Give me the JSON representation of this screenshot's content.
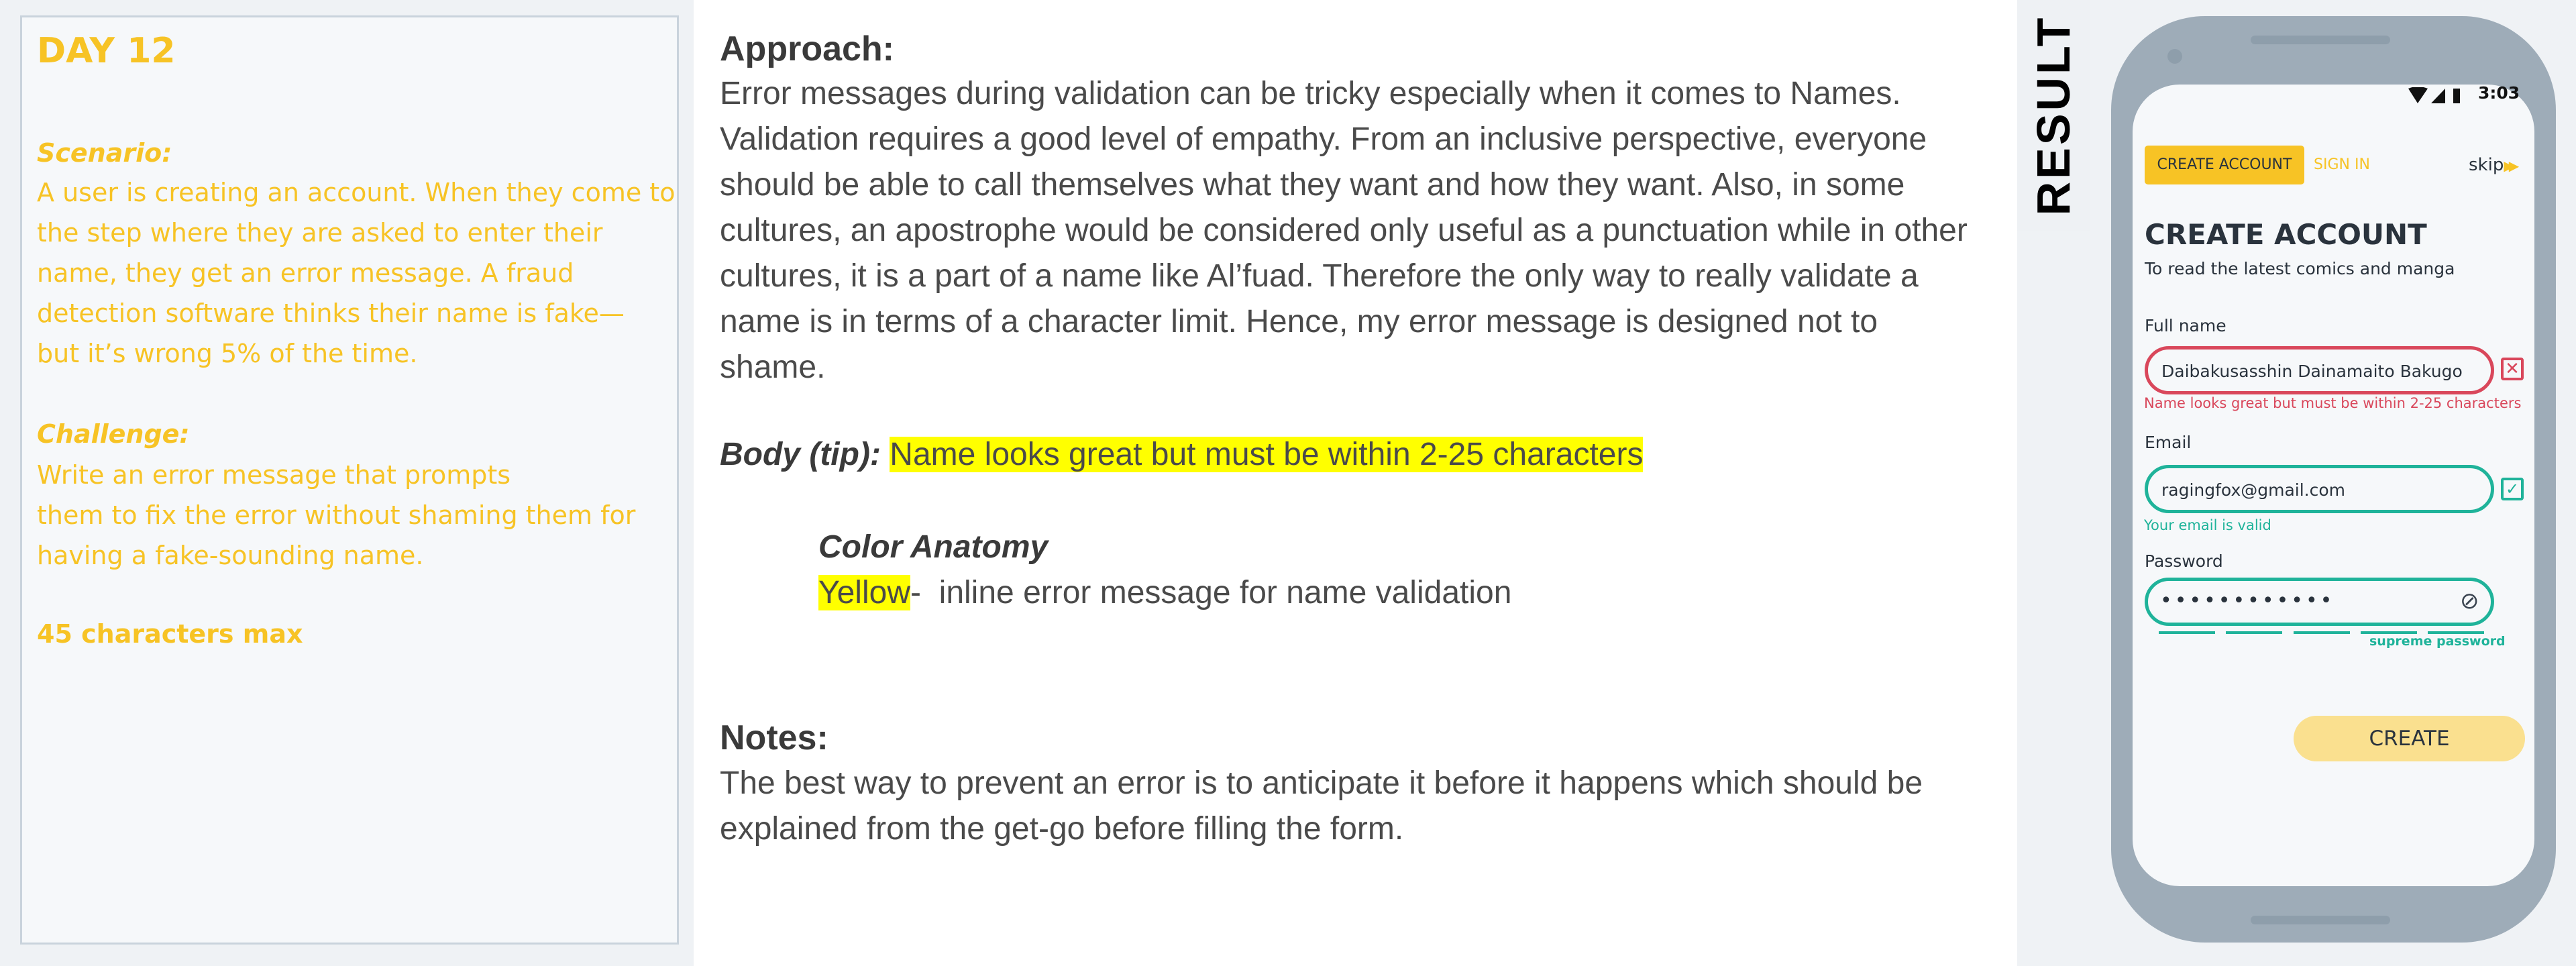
{
  "brief": {
    "day": "DAY 12",
    "scenario_heading": "Scenario:",
    "scenario_lines": [
      "A user is creating an account. When they come to",
      "the step where they are asked to enter their",
      "name, they get an error message. A fraud",
      "detection software thinks their name is fake—",
      "but it’s wrong 5% of the time."
    ],
    "challenge_heading": "Challenge:",
    "challenge_lines": [
      "Write an error message that prompts",
      "them to fix the error without shaming them for",
      "having a fake-sounding name."
    ],
    "limit": "45 characters max"
  },
  "notes": {
    "approach_heading": "Approach:",
    "approach_lines": [
      "Error messages during validation can be tricky especially when it comes to Names.",
      "Validation requires a good level of empathy. From an inclusive perspective, everyone",
      "should be able to call themselves what they want and how they want. Also, in some",
      "cultures, an apostrophe would be considered only useful as a punctuation while in other",
      "cultures, it is a part of a name like Al’fuad. Therefore the only way to really validate a",
      "name is in terms of a character limit. Hence, my error message is designed not to",
      "shame."
    ],
    "body_label": "Body (tip):",
    "body_text": "Name looks great but must be within 2-25 characters",
    "color_anatomy_heading": "Color Anatomy",
    "color_name": "Yellow",
    "color_desc": "-  inline error message for name validation",
    "notes_heading": "Notes:",
    "notes_lines": [
      "The best way to prevent an error is to anticipate it before it happens which should be",
      "explained from the get-go before filling the form."
    ]
  },
  "result_label": "RESULT",
  "phone": {
    "time": "3:03",
    "tab_create": "CREATE ACCOUNT",
    "tab_signin": "SIGN IN",
    "skip": "skip",
    "title": "CREATE ACCOUNT",
    "subtitle": "To read the latest comics and manga",
    "fullname_label": "Full name",
    "fullname_value": "Daibakusasshin Dainamaito Bakugo",
    "fullname_error": "Name looks great but must be within 2-25 characters",
    "email_label": "Email",
    "email_value": "ragingfox@gmail.com",
    "email_valid": "Your email is valid",
    "password_label": "Password",
    "password_value": "••••••••••••",
    "password_strength": "supreme password",
    "password_strength_level": 5,
    "create_button": "CREATE"
  },
  "colors": {
    "accent_yellow": "#f7c325",
    "error_red": "#d9475b",
    "valid_teal": "#1fb39a",
    "highlight": "#ffff00"
  }
}
